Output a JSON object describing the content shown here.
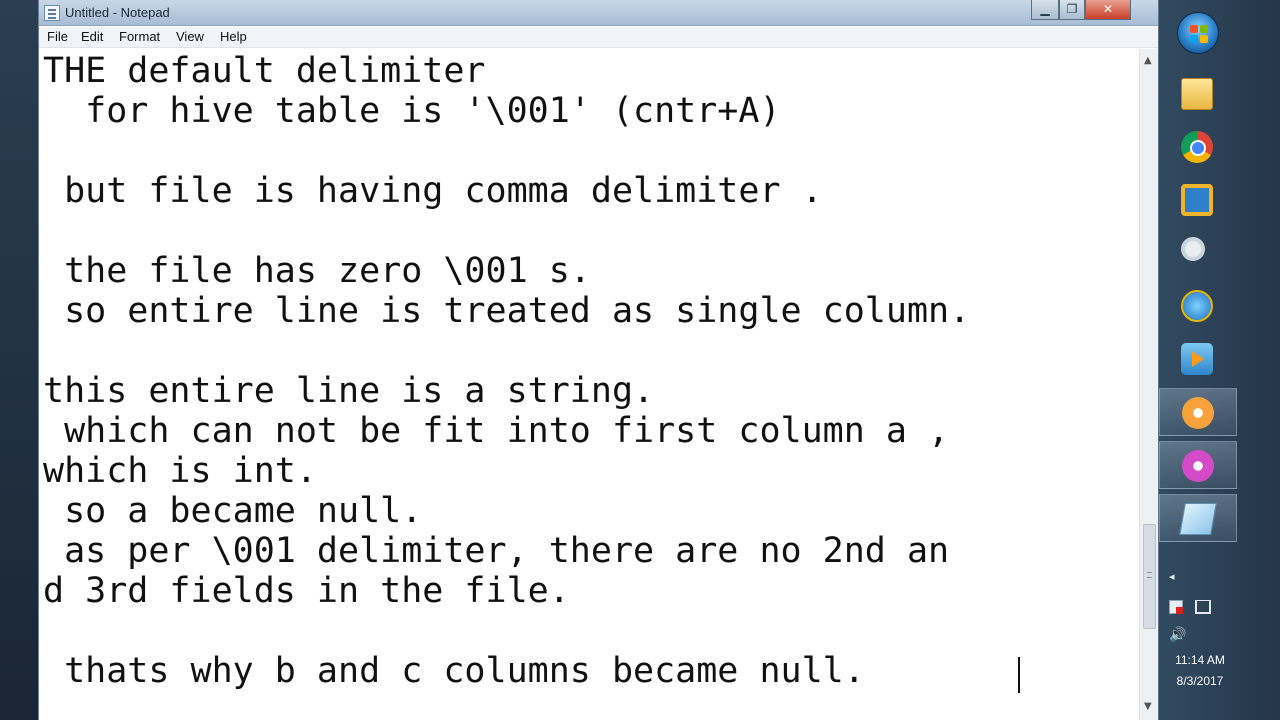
{
  "window": {
    "title": "Untitled - Notepad",
    "min_symbol": "▁",
    "max_symbol": "❐",
    "close_symbol": "✕"
  },
  "menu": {
    "items": [
      "File",
      "Edit",
      "Format",
      "View",
      "Help"
    ]
  },
  "editor": {
    "lines": [
      "THE default delimiter",
      "  for hive table is '\\001' (cntr+A)",
      "",
      " but file is having comma delimiter .",
      "",
      " the file has zero \\001 s.",
      " so entire line is treated as single column.",
      "",
      "this entire line is a string.",
      " which can not be fit into first column a ,",
      "which is int.",
      " so a became null.",
      " as per \\001 delimiter, there are no 2nd an",
      "d 3rd fields in the file.",
      "",
      " thats why b and c columns became null."
    ]
  },
  "taskbar": {
    "icons": [
      "start-orb",
      "folder-icon",
      "chrome-icon",
      "vm-icon",
      "search-icon",
      "ie-icon",
      "media-player-icon",
      "flower-app-icon",
      "flower-app-icon",
      "notepad-icon"
    ],
    "tray": {
      "expand_symbol": "◂",
      "volume_symbol": "🔊"
    },
    "clock": {
      "time": "11:14 AM",
      "date": "8/3/2017"
    }
  },
  "colors": {
    "text": "#111111",
    "close_button": "#c9412b",
    "taskbar": "#243648"
  }
}
